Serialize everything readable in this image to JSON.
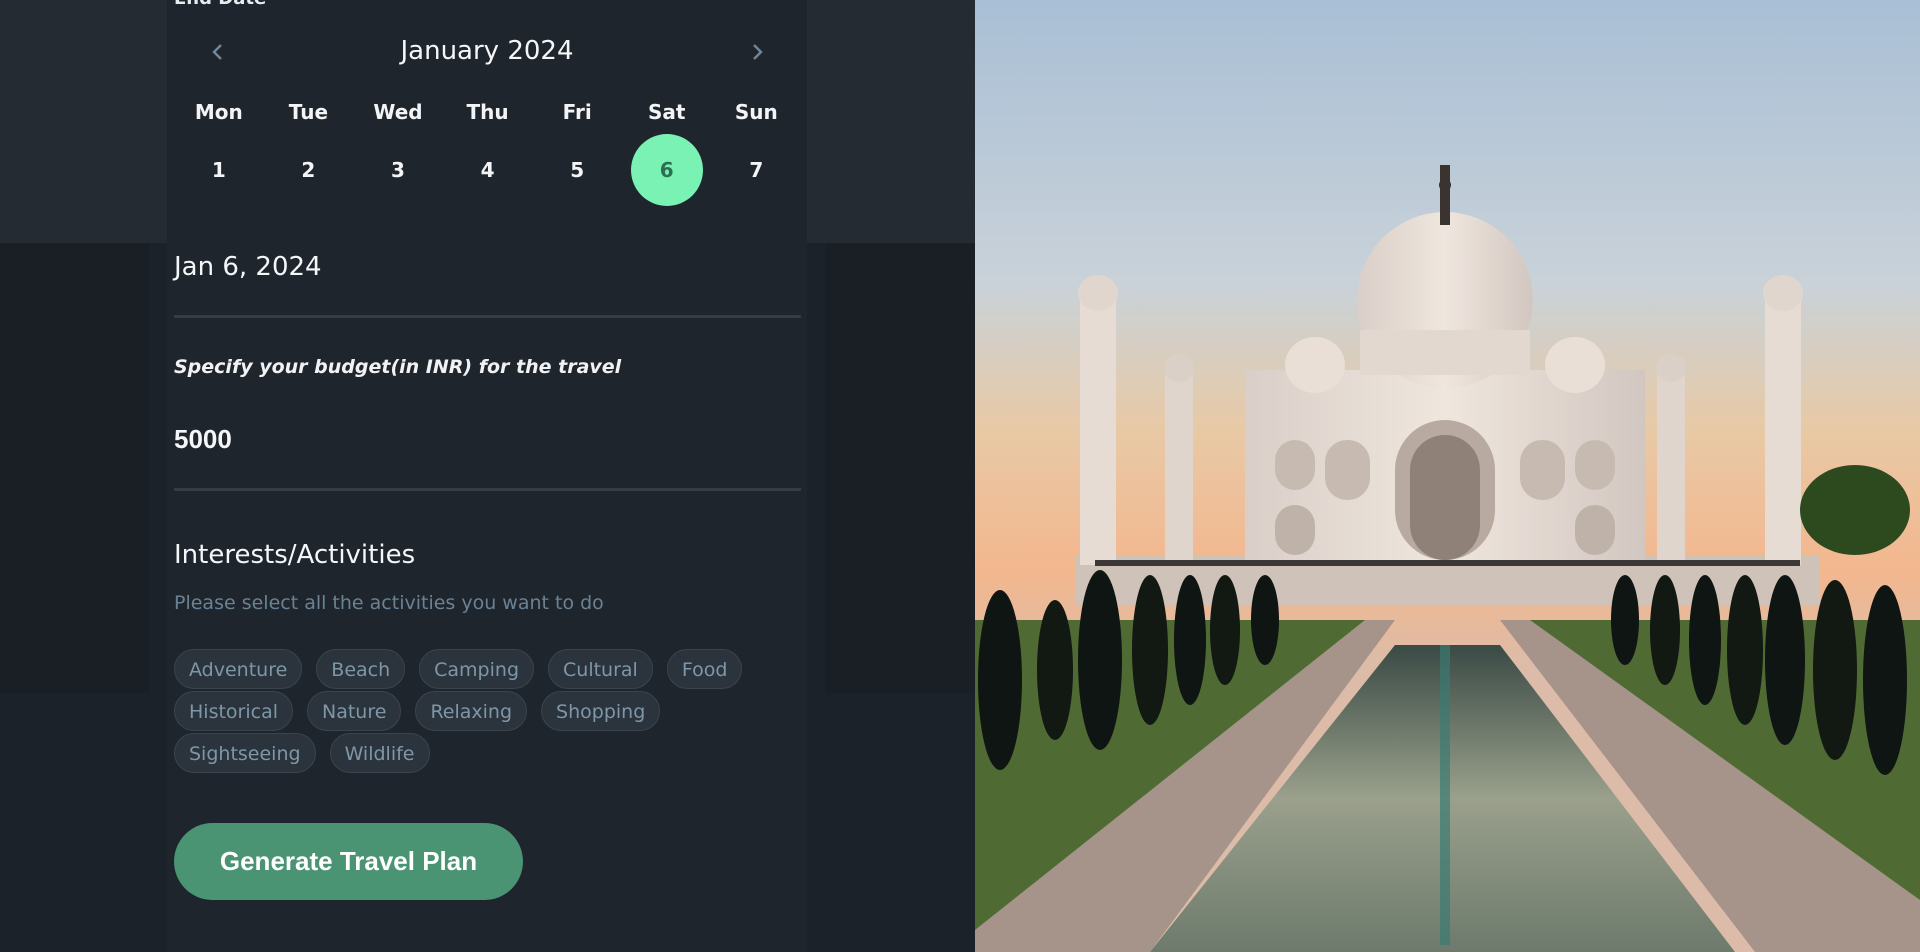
{
  "calendar": {
    "cut_label": "End Date",
    "month_label": "January 2024",
    "weekdays": [
      "Mon",
      "Tue",
      "Wed",
      "Thu",
      "Fri",
      "Sat",
      "Sun"
    ],
    "days": [
      "1",
      "2",
      "3",
      "4",
      "5",
      "6",
      "7"
    ],
    "selected_day": "6"
  },
  "date_field": {
    "value": "Jan 6, 2024"
  },
  "budget": {
    "label": "Specify your budget(in INR) for the travel",
    "value": "5000"
  },
  "interests": {
    "title": "Interests/Activities",
    "subtitle": "Please select all the activities you want to do",
    "rows": [
      [
        "Adventure",
        "Beach",
        "Camping",
        "Cultural",
        "Food"
      ],
      [
        "Historical",
        "Nature",
        "Relaxing",
        "Shopping"
      ],
      [
        "Sightseeing",
        "Wildlife"
      ]
    ]
  },
  "cta": {
    "label": "Generate Travel Plan"
  },
  "colors": {
    "accent": "#7af2b4",
    "button": "#4a9473",
    "panel": "#1f252d"
  },
  "icons": {
    "prev": "chevron-left-icon",
    "next": "chevron-right-icon"
  }
}
